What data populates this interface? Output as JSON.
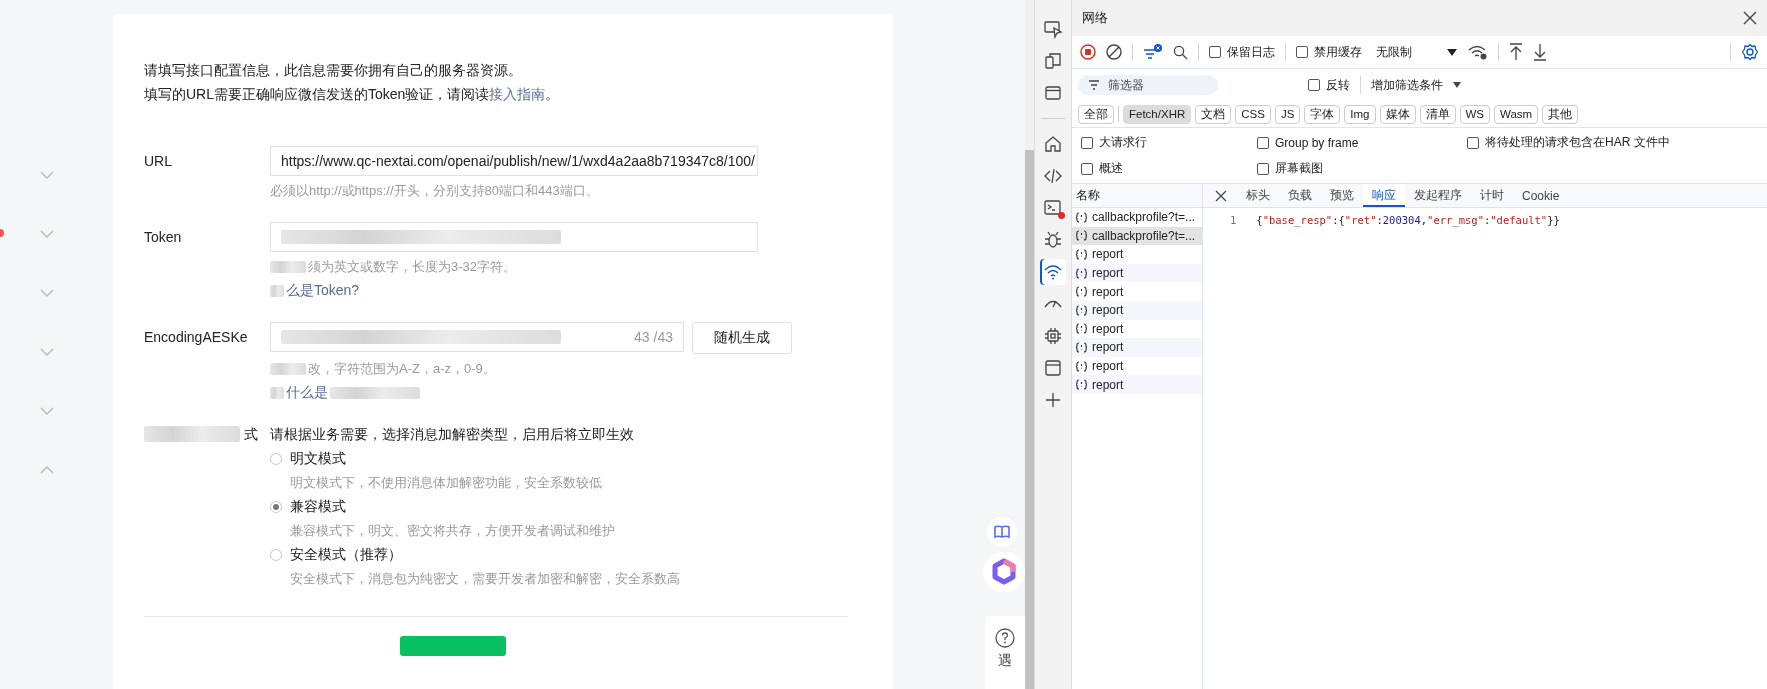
{
  "sidebar": {
    "items": [
      {
        "expanded": false,
        "alert": false
      },
      {
        "expanded": false,
        "alert": true
      },
      {
        "expanded": false,
        "alert": false
      },
      {
        "expanded": false,
        "alert": false
      },
      {
        "expanded": false,
        "alert": false
      },
      {
        "expanded": true,
        "alert": false
      }
    ]
  },
  "form": {
    "intro": [
      "请填写接口配置信息，此信息需要你拥有自己的服务器资源。"
    ],
    "intro_link_line": {
      "text": "填写的URL需要正确响应微信发送的Token验证，请阅读",
      "link": "接入指南",
      "after": "。"
    },
    "fields": [
      {
        "kind": "text",
        "label": "URL",
        "value": "https://www.qc-nextai.com/openai/publish/new/1/wxd4a2aa8b719347c8/100/",
        "hint": "必须以http://或https://开头，分别支持80端口和443端口。"
      },
      {
        "kind": "text",
        "label": "Token",
        "redacted": true,
        "hint": "须为英文或数字，长度为3-32字符。",
        "link": "么是Token?"
      },
      {
        "kind": "key",
        "label": "EncodingAESKe",
        "redacted": true,
        "counter": "43 /43",
        "button": "随机生成",
        "hint": "改，字符范围为A-Z，a-z，0-9。",
        "link": "什么是"
      },
      {
        "kind": "radio",
        "label": "式",
        "intro": "请根据业务需要，选择消息加解密类型，启用后将立即生效",
        "options": [
          {
            "label": "明文模式",
            "hint": "明文模式下，不使用消息体加解密功能，安全系数较低",
            "selected": false
          },
          {
            "label": "兼容模式",
            "hint": "兼容模式下，明文、密文将共存，方便开发者调试和维护",
            "selected": true
          },
          {
            "label": "安全模式（推荐）",
            "hint": "安全模式下，消息包为纯密文，需要开发者加密和解密，安全系数高",
            "selected": false
          }
        ]
      }
    ]
  },
  "help": {
    "label": "遇"
  },
  "devtools": {
    "title": "网络",
    "activity": [
      {
        "selected": false,
        "badge": false
      },
      {
        "selected": false,
        "badge": false
      },
      {
        "selected": false,
        "badge": false
      },
      {
        "selected": false,
        "badge": false
      },
      {
        "selected": false,
        "badge": false
      },
      {
        "selected": false,
        "badge": true
      },
      {
        "selected": false,
        "badge": false
      },
      {
        "selected": true,
        "badge": false
      },
      {
        "selected": false,
        "badge": false
      },
      {
        "selected": false,
        "badge": false
      },
      {
        "selected": false,
        "badge": false
      },
      {
        "selected": false,
        "badge": false
      }
    ],
    "toolbar": {
      "recording": true,
      "preserve_log": {
        "label": "保留日志",
        "checked": false
      },
      "disable_cache": {
        "label": "禁用缓存",
        "checked": false
      },
      "throttle": "无限制"
    },
    "filter": {
      "placeholder": "筛选器",
      "invert": {
        "label": "反转",
        "checked": false
      },
      "more": "增加筛选条件"
    },
    "types": [
      {
        "label": "全部",
        "selected": false
      },
      {
        "label": "Fetch/XHR",
        "selected": true
      },
      {
        "label": "文档",
        "selected": false
      },
      {
        "label": "CSS",
        "selected": false
      },
      {
        "label": "JS",
        "selected": false
      },
      {
        "label": "字体",
        "selected": false
      },
      {
        "label": "Img",
        "selected": false
      },
      {
        "label": "媒体",
        "selected": false
      },
      {
        "label": "清单",
        "selected": false
      },
      {
        "label": "WS",
        "selected": false
      },
      {
        "label": "Wasm",
        "selected": false
      },
      {
        "label": "其他",
        "selected": false
      }
    ],
    "options": [
      {
        "label": "大请求行",
        "checked": false
      },
      {
        "label": "Group by frame",
        "checked": false
      },
      {
        "label": "将待处理的请求包含在HAR 文件中",
        "checked": false
      },
      {
        "label": "概述",
        "checked": false
      },
      {
        "label": "屏幕截图",
        "checked": false
      }
    ],
    "name_header": "名称",
    "requests": [
      {
        "name": "callbackprofile?t=...",
        "selected": false
      },
      {
        "name": "callbackprofile?t=...",
        "selected": true
      },
      {
        "name": "report",
        "selected": false
      },
      {
        "name": "report",
        "selected": false
      },
      {
        "name": "report",
        "selected": false
      },
      {
        "name": "report",
        "selected": false
      },
      {
        "name": "report",
        "selected": false
      },
      {
        "name": "report",
        "selected": false
      },
      {
        "name": "report",
        "selected": false
      },
      {
        "name": "report",
        "selected": false
      }
    ],
    "detail_tabs": [
      {
        "label": "标头",
        "selected": false
      },
      {
        "label": "负载",
        "selected": false
      },
      {
        "label": "预览",
        "selected": false
      },
      {
        "label": "响应",
        "selected": true
      },
      {
        "label": "发起程序",
        "selected": false
      },
      {
        "label": "计时",
        "selected": false
      },
      {
        "label": "Cookie",
        "selected": false
      }
    ],
    "response": {
      "line": "1",
      "tokens": [
        {
          "kind": "punct",
          "text": "{"
        },
        {
          "kind": "string",
          "text": "\"base_resp\""
        },
        {
          "kind": "punct",
          "text": ":{"
        },
        {
          "kind": "string",
          "text": "\"ret\""
        },
        {
          "kind": "punct",
          "text": ":"
        },
        {
          "kind": "number",
          "text": "200304"
        },
        {
          "kind": "punct",
          "text": ","
        },
        {
          "kind": "string",
          "text": "\"err_msg\""
        },
        {
          "kind": "punct",
          "text": ":"
        },
        {
          "kind": "string",
          "text": "\"default\""
        },
        {
          "kind": "punct",
          "text": "}}"
        }
      ]
    }
  }
}
